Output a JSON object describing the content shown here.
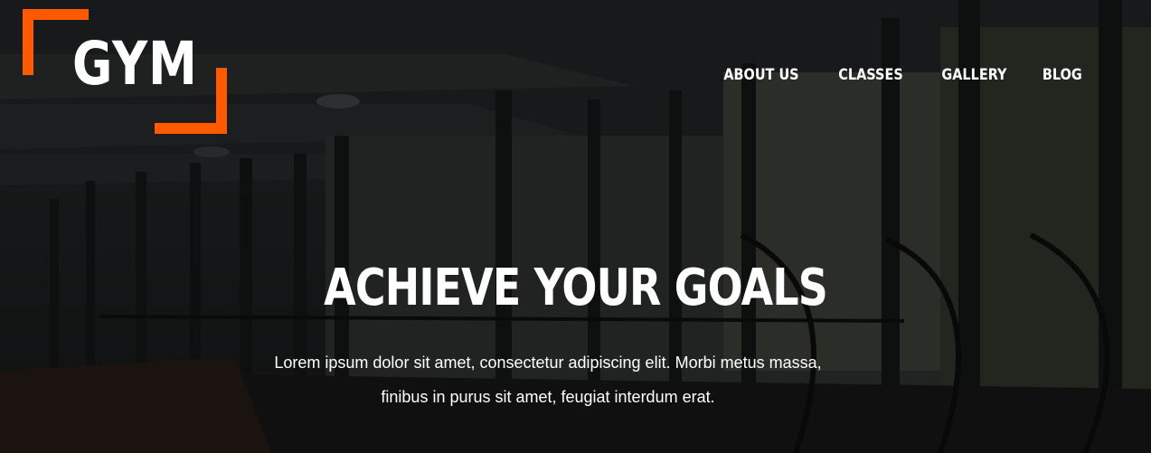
{
  "brand": {
    "logo_text": "GYM",
    "accent": "#ff5a00"
  },
  "nav": {
    "items": [
      "ABOUT US",
      "CLASSES",
      "GALLERY",
      "BLOG"
    ]
  },
  "hero": {
    "headline": "ACHIEVE YOUR GOALS",
    "description": "Lorem ipsum dolor sit amet, consectetur adipiscing elit. Morbi metus massa, finibus in purus sit amet, feugiat interdum erat."
  }
}
